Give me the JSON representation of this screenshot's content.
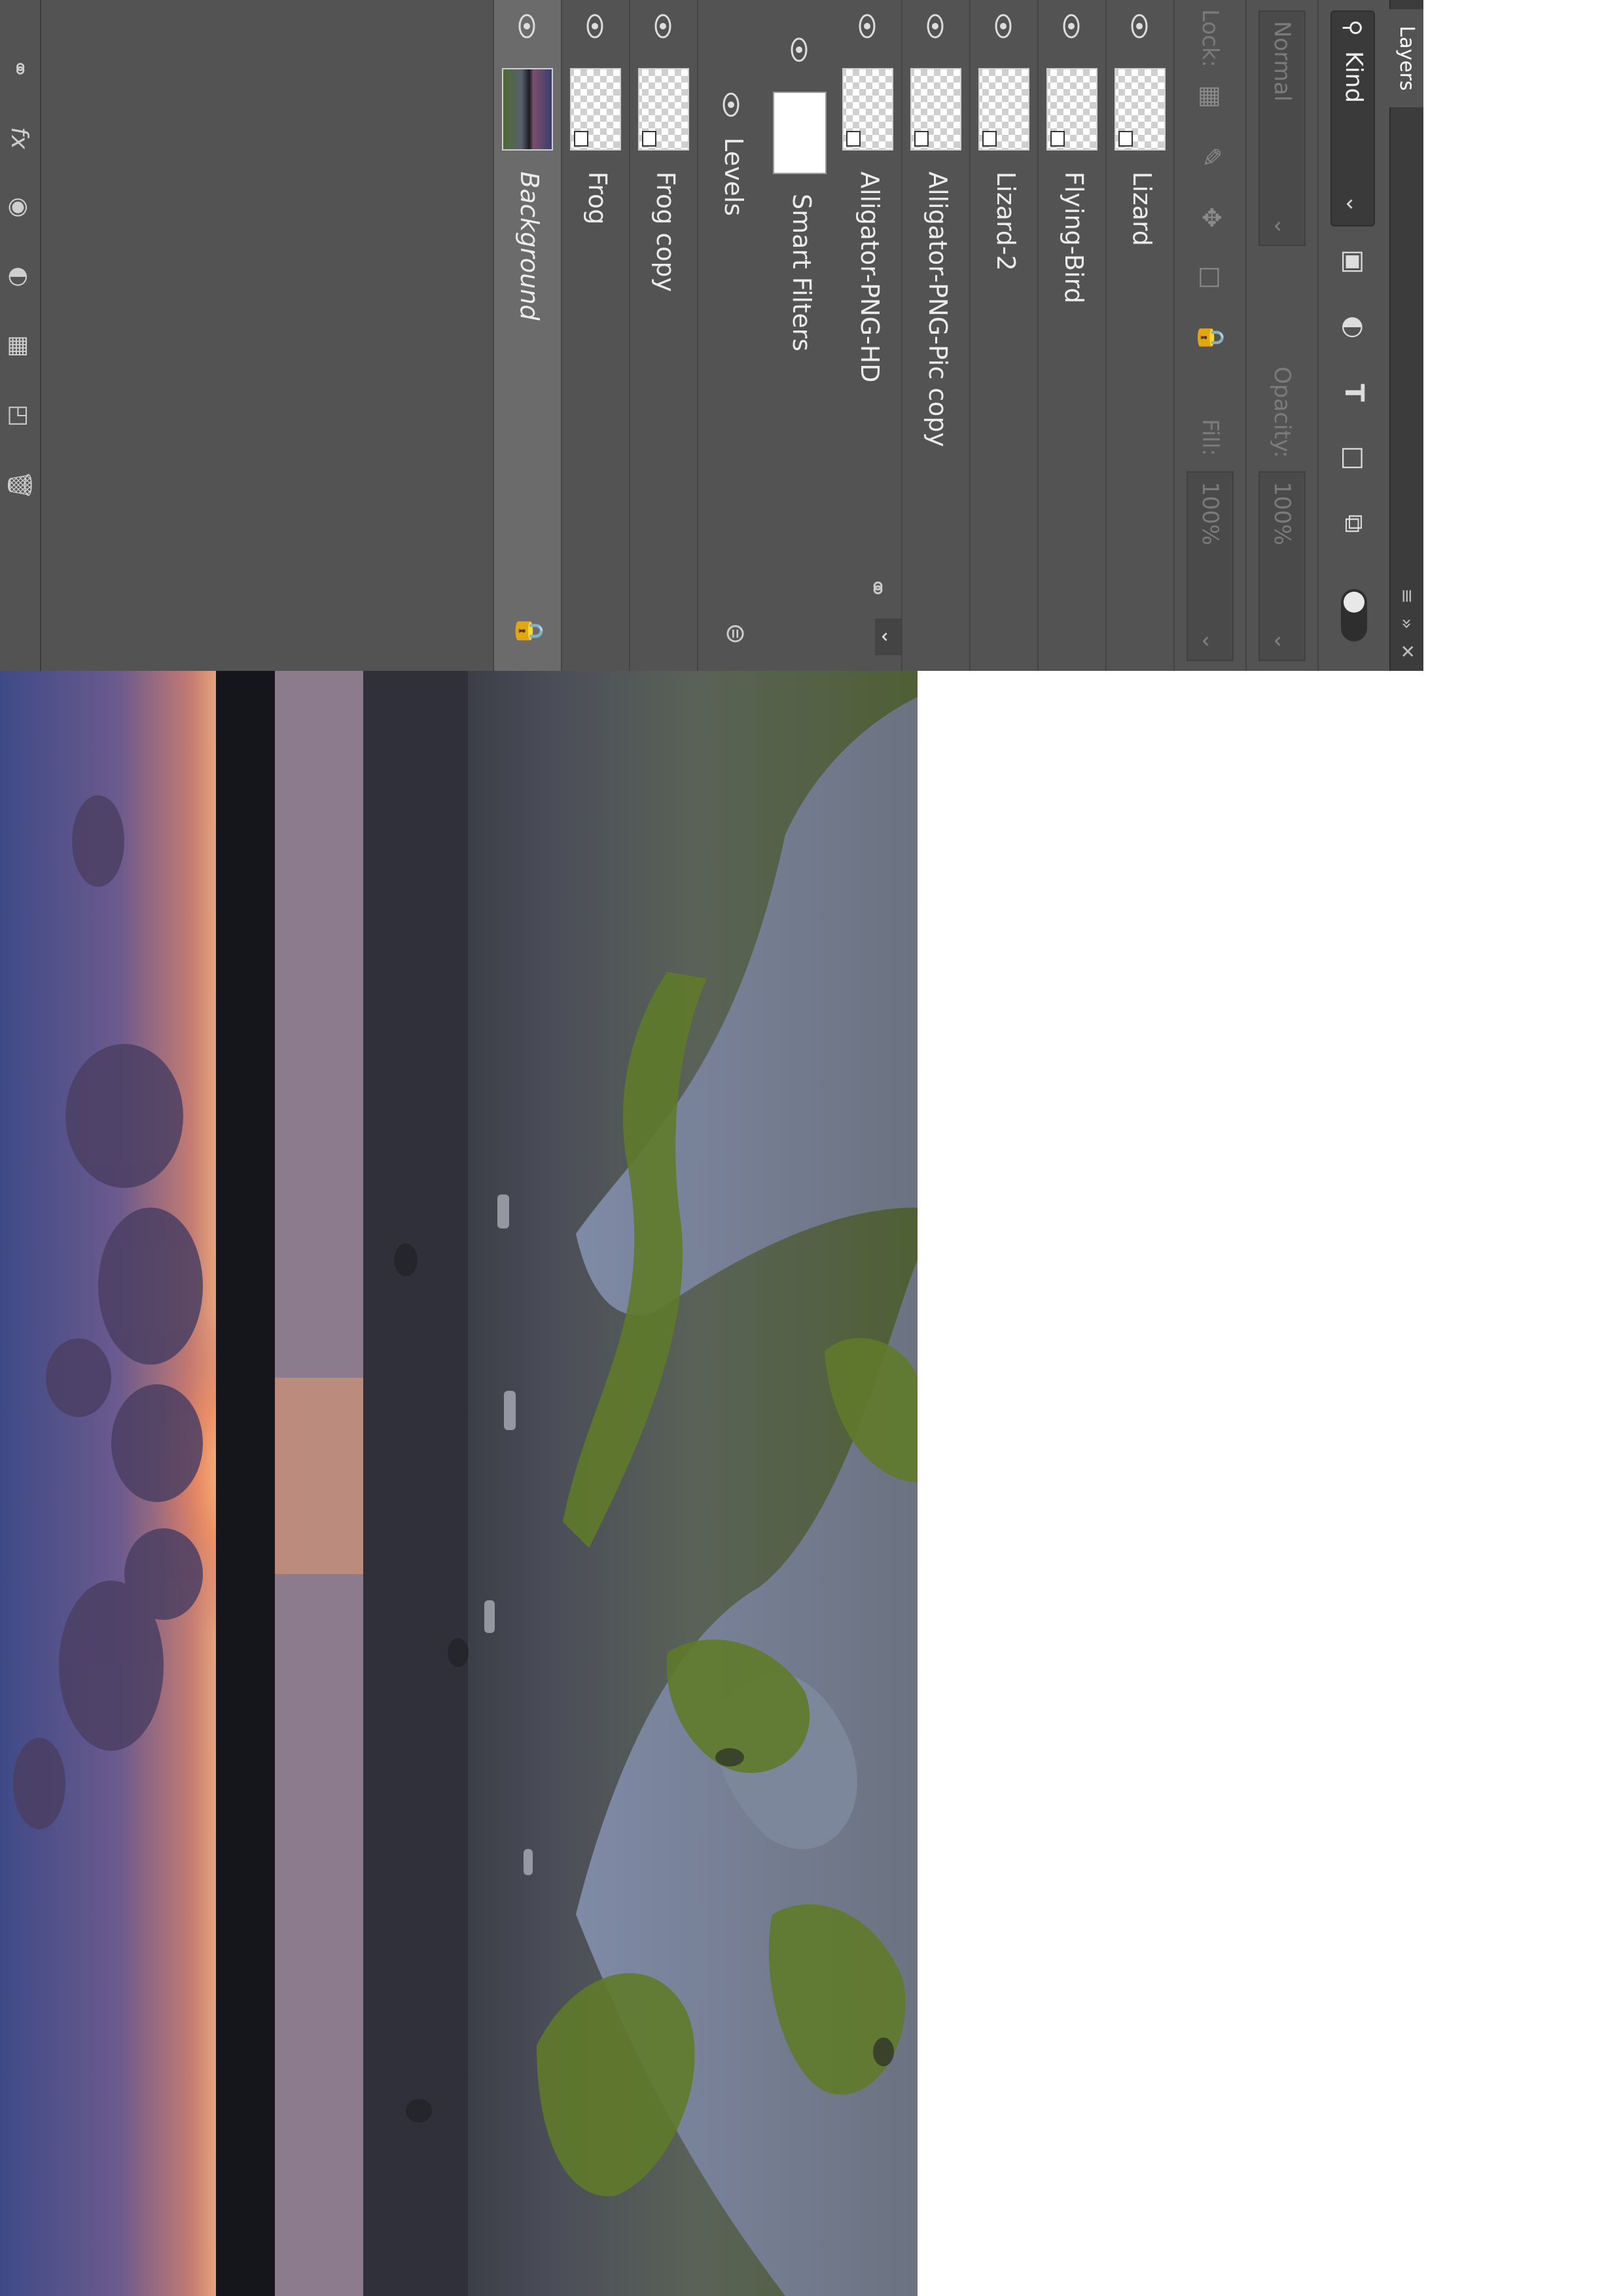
{
  "panel": {
    "tab_label": "Layers",
    "topbar_icons": [
      "collapse-icon",
      "close-icon",
      "menu-icon"
    ],
    "filter": {
      "kind_label": "Kind",
      "icons": [
        "image-filter-icon",
        "adjustment-filter-icon",
        "type-filter-icon",
        "shape-filter-icon",
        "smart-object-filter-icon"
      ]
    },
    "blend_mode": "Normal",
    "opacity_label": "Opacity:",
    "opacity_value": "100%",
    "lock_label": "Lock:",
    "fill_label": "Fill:",
    "fill_value": "100%",
    "lock_icons": [
      "lock-transparent-icon",
      "lock-paint-icon",
      "lock-move-icon",
      "lock-artboard-icon",
      "lock-all-icon"
    ],
    "layers": [
      {
        "name": "Lizard",
        "type": "smart-object"
      },
      {
        "name": "Flying-Bird",
        "type": "smart-object"
      },
      {
        "name": "Lizard-2",
        "type": "smart-object"
      },
      {
        "name": "Alligator-PNG-Pic copy",
        "type": "smart-object"
      },
      {
        "name": "Alligator-PNG-HD",
        "type": "smart-object"
      },
      {
        "name": "Frog copy",
        "type": "smart-object"
      },
      {
        "name": "Frog",
        "type": "smart-object"
      },
      {
        "name": "Background",
        "type": "background",
        "locked": true,
        "selected": true
      }
    ],
    "smart_filters": {
      "label": "Smart Filters",
      "filter_name": "Levels"
    },
    "bottom_icons": [
      "link-icon",
      "fx-icon",
      "mask-icon",
      "adjustment-icon",
      "group-icon",
      "new-layer-icon",
      "delete-icon"
    ]
  },
  "colors": {
    "panel_bg": "#535353",
    "topbar_bg": "#3c3c3c",
    "selected_layer": "#6b6b6b",
    "text": "#ececec"
  }
}
